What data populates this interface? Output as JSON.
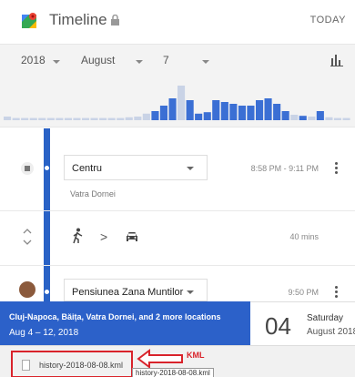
{
  "header": {
    "title": "Timeline",
    "today_label": "TODAY",
    "logo_icon": "google-maps-logo",
    "lock_icon": "lock-icon"
  },
  "date_selector": {
    "year": "2018",
    "month": "August",
    "day": "7",
    "chart_icon": "bar-chart-icon"
  },
  "histogram": {
    "accent": "#3b6fd4",
    "faded": "#c9d3e6",
    "bars": [
      {
        "v": 0.1,
        "s": 0
      },
      {
        "v": 0.06,
        "s": 0
      },
      {
        "v": 0.06,
        "s": 0
      },
      {
        "v": 0.06,
        "s": 0
      },
      {
        "v": 0.06,
        "s": 0
      },
      {
        "v": 0.06,
        "s": 0
      },
      {
        "v": 0.06,
        "s": 0
      },
      {
        "v": 0.06,
        "s": 0
      },
      {
        "v": 0.06,
        "s": 0
      },
      {
        "v": 0.06,
        "s": 0
      },
      {
        "v": 0.06,
        "s": 0
      },
      {
        "v": 0.06,
        "s": 0
      },
      {
        "v": 0.06,
        "s": 0
      },
      {
        "v": 0.06,
        "s": 0
      },
      {
        "v": 0.08,
        "s": 0
      },
      {
        "v": 0.1,
        "s": 0
      },
      {
        "v": 0.18,
        "s": 0
      },
      {
        "v": 0.25,
        "s": 1
      },
      {
        "v": 0.4,
        "s": 1
      },
      {
        "v": 0.6,
        "s": 1
      },
      {
        "v": 0.95,
        "s": 0
      },
      {
        "v": 0.55,
        "s": 1
      },
      {
        "v": 0.18,
        "s": 1
      },
      {
        "v": 0.22,
        "s": 1
      },
      {
        "v": 0.55,
        "s": 1
      },
      {
        "v": 0.5,
        "s": 1
      },
      {
        "v": 0.45,
        "s": 1
      },
      {
        "v": 0.4,
        "s": 1
      },
      {
        "v": 0.4,
        "s": 1
      },
      {
        "v": 0.55,
        "s": 1
      },
      {
        "v": 0.6,
        "s": 1
      },
      {
        "v": 0.45,
        "s": 1
      },
      {
        "v": 0.25,
        "s": 1
      },
      {
        "v": 0.15,
        "s": 0
      },
      {
        "v": 0.12,
        "s": 1
      },
      {
        "v": 0.1,
        "s": 0
      },
      {
        "v": 0.25,
        "s": 1
      },
      {
        "v": 0.08,
        "s": 0
      },
      {
        "v": 0.06,
        "s": 0
      },
      {
        "v": 0.06,
        "s": 0
      }
    ]
  },
  "timeline": {
    "line_color": "#2962c6",
    "stop1": {
      "place": "Centru",
      "subtitle": "Vatra Dornei",
      "time": "8:58 PM - 9:11 PM"
    },
    "movement": {
      "duration": "40 mins",
      "icons": [
        "expand-icon",
        "walk-icon",
        "car-icon"
      ],
      "separator": ">"
    },
    "stop2": {
      "place": "Pensiunea Zana Muntilor",
      "time": "9:50 PM"
    }
  },
  "summary": {
    "places": "Cluj-Napoca, Băița, Vatra Dornei, and 2 more locations",
    "dates": "Aug 4 – 12, 2018",
    "day_number": "04",
    "day_name": "Saturday",
    "month_year": "August 2018",
    "background": "#2c61c9"
  },
  "download": {
    "file_name": "history-2018-08-08.kml",
    "chevron": "^",
    "annotation_label": "KML",
    "tooltip": "history-2018-08-08.kml",
    "highlight_color": "#d9232b"
  }
}
